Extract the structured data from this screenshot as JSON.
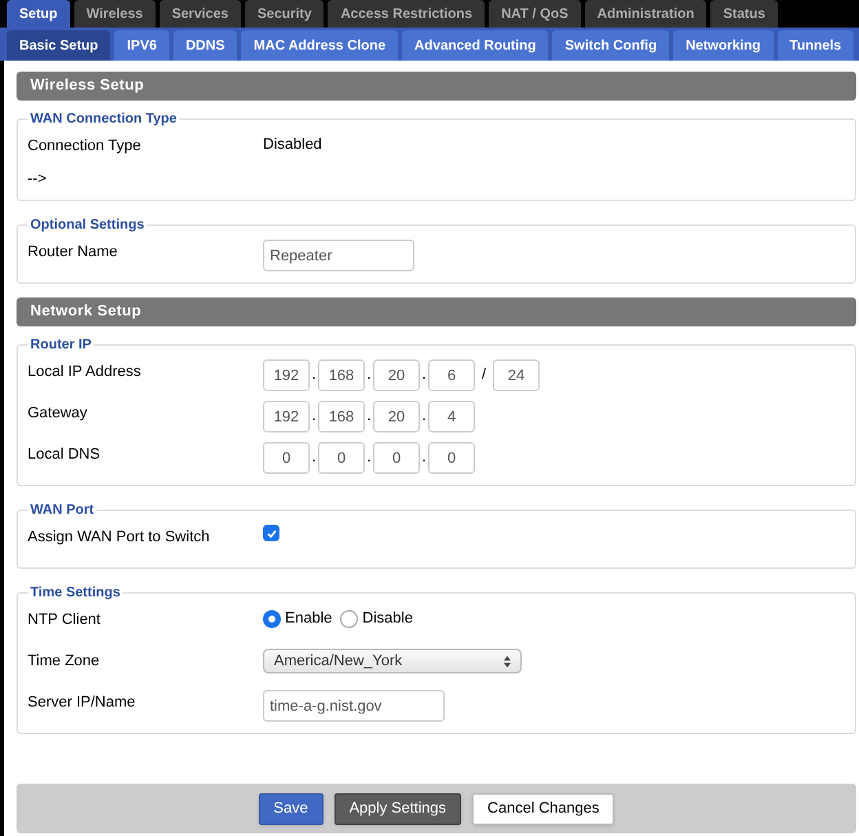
{
  "main_tabs": [
    {
      "label": "Setup",
      "selected": true
    },
    {
      "label": "Wireless",
      "selected": false
    },
    {
      "label": "Services",
      "selected": false
    },
    {
      "label": "Security",
      "selected": false
    },
    {
      "label": "Access Restrictions",
      "selected": false
    },
    {
      "label": "NAT / QoS",
      "selected": false
    },
    {
      "label": "Administration",
      "selected": false
    },
    {
      "label": "Status",
      "selected": false
    }
  ],
  "sub_tabs": [
    {
      "label": "Basic Setup",
      "selected": true
    },
    {
      "label": "IPV6",
      "selected": false
    },
    {
      "label": "DDNS",
      "selected": false
    },
    {
      "label": "MAC Address Clone",
      "selected": false
    },
    {
      "label": "Advanced Routing",
      "selected": false
    },
    {
      "label": "Switch Config",
      "selected": false
    },
    {
      "label": "Networking",
      "selected": false
    },
    {
      "label": "Tunnels",
      "selected": false
    }
  ],
  "sections": [
    {
      "title": "Wireless Setup",
      "groups": [
        {
          "legend": "WAN Connection Type",
          "rows": [
            {
              "kind": "text",
              "label": "Connection Type",
              "value": "Disabled"
            },
            {
              "kind": "note",
              "label": "-->"
            }
          ]
        },
        {
          "legend": "Optional Settings",
          "rows": [
            {
              "kind": "input",
              "label": "Router Name",
              "value": "Repeater"
            }
          ]
        }
      ]
    },
    {
      "title": "Network Setup",
      "groups": [
        {
          "legend": "Router IP",
          "rows": [
            {
              "kind": "ip",
              "label": "Local IP Address",
              "octets": [
                "192",
                "168",
                "20",
                "6"
              ],
              "dot": ".",
              "separator": "/",
              "mask": "24"
            },
            {
              "kind": "ip",
              "label": "Gateway",
              "octets": [
                "192",
                "168",
                "20",
                "4"
              ],
              "dot": "."
            },
            {
              "kind": "ip",
              "label": "Local DNS",
              "octets": [
                "0",
                "0",
                "0",
                "0"
              ],
              "dot": "."
            }
          ]
        },
        {
          "legend": "WAN Port",
          "rows": [
            {
              "kind": "checkbox",
              "label": "Assign WAN Port to Switch",
              "checked": true
            }
          ]
        },
        {
          "legend": "Time Settings",
          "rows": [
            {
              "kind": "radio",
              "label": "NTP Client",
              "options": [
                {
                  "label": "Enable",
                  "selected": true
                },
                {
                  "label": "Disable",
                  "selected": false
                }
              ]
            },
            {
              "kind": "select",
              "label": "Time Zone",
              "value": "America/New_York"
            },
            {
              "kind": "input",
              "label": "Server IP/Name",
              "value": "time-a-g.nist.gov"
            }
          ]
        }
      ]
    }
  ],
  "buttons": [
    {
      "label": "Save",
      "kind": "primary"
    },
    {
      "label": "Apply Settings",
      "kind": "dark"
    },
    {
      "label": "Cancel Changes",
      "kind": "light"
    }
  ]
}
